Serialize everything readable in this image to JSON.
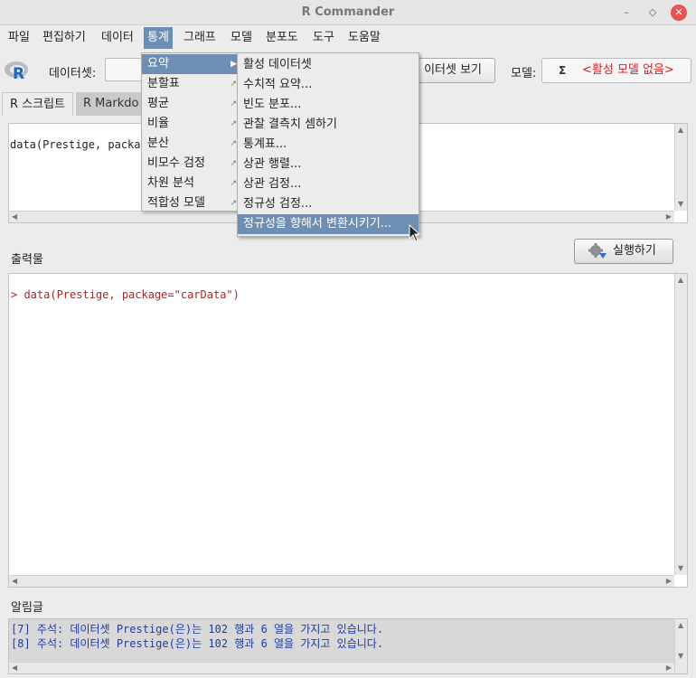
{
  "window": {
    "title": "R Commander"
  },
  "menubar": [
    "파일",
    "편집하기",
    "데이터",
    "통계",
    "그래프",
    "모델",
    "분포도",
    "도구",
    "도움말"
  ],
  "toolbar": {
    "dataset_label": "데이터셋:",
    "dataset_value": "",
    "view_dataset_label": "이터셋 보기",
    "model_label": "모델:",
    "model_sigma": "Σ",
    "model_value": "<활성 모델 없음>"
  },
  "tabs": [
    "R 스크립트",
    "R Markdo"
  ],
  "script": {
    "code": "data(Prestige, packag"
  },
  "output": {
    "label": "출력물",
    "run_label": "실행하기",
    "code": "> data(Prestige, package=\"carData\")"
  },
  "messages": {
    "label": "알림글",
    "lines": [
      "[7] 주석: 데이터셋 Prestige(은)는 102 행과 6 열을 가지고 있습니다.",
      "[8] 주석: 데이터셋 Prestige(은)는 102 행과 6 열을 가지고 있습니다."
    ]
  },
  "stats_menu": [
    "요약",
    "분할표",
    "평균",
    "비율",
    "분산",
    "비모수 검정",
    "차원 분석",
    "적합성 모델"
  ],
  "summary_submenu": [
    "활성 데이터셋",
    "수치적 요약...",
    "빈도 분포...",
    "관찰 결측치 셈하기",
    "통계표...",
    "상관 행렬...",
    "상관 검정...",
    "정규성 검정...",
    "정규성을 향해서 변환시키기..."
  ],
  "colors": {
    "highlight": "#6c8fb3",
    "model_none": "#d6201f",
    "message_text": "#1f3aa6",
    "output_text": "#b22222"
  }
}
